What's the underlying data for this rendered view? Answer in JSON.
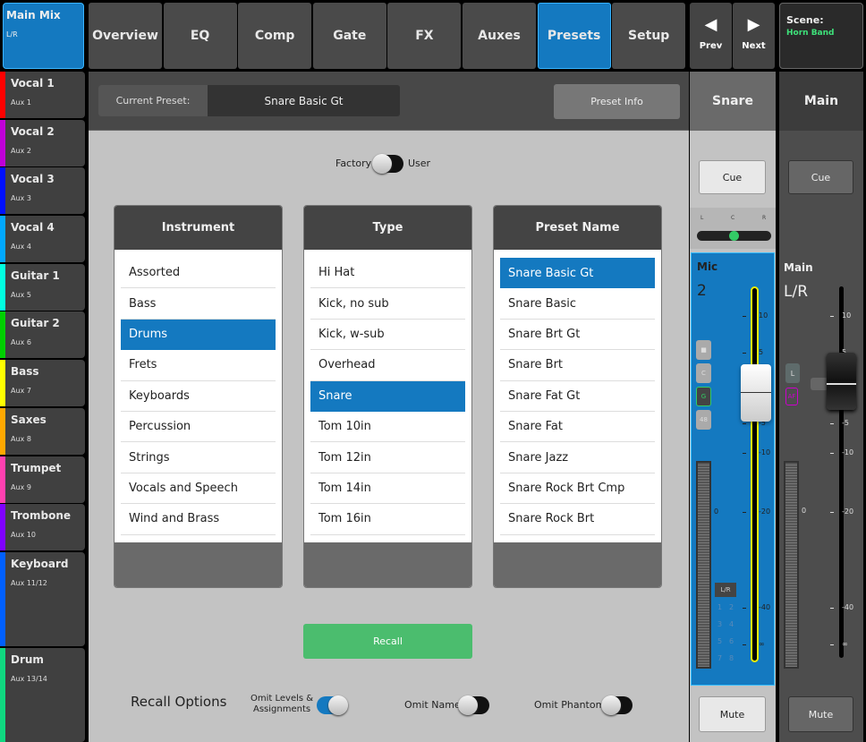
{
  "sidebar": {
    "main": {
      "name": "Main Mix",
      "sub": "L/R",
      "color": "#1479c0"
    },
    "channels": [
      {
        "name": "Vocal 1",
        "aux": "Aux 1",
        "color": "#ff0000"
      },
      {
        "name": "Vocal 2",
        "aux": "Aux 2",
        "color": "#c000d8"
      },
      {
        "name": "Vocal 3",
        "aux": "Aux 3",
        "color": "#0010ff"
      },
      {
        "name": "Vocal 4",
        "aux": "Aux 4",
        "color": "#00a8ff"
      },
      {
        "name": "Guitar 1",
        "aux": "Aux 5",
        "color": "#00ffe0"
      },
      {
        "name": "Guitar 2",
        "aux": "Aux 6",
        "color": "#00d000"
      },
      {
        "name": "Bass",
        "aux": "Aux 7",
        "color": "#ffff00"
      },
      {
        "name": "Saxes",
        "aux": "Aux 8",
        "color": "#ffa800"
      },
      {
        "name": "Trumpet",
        "aux": "Aux 9",
        "color": "#ff40b0"
      },
      {
        "name": "Trombone",
        "aux": "Aux 10",
        "color": "#8000ff"
      },
      {
        "name": "Keyboard",
        "aux": "Aux 11/12",
        "color": "#0060ff"
      },
      {
        "name": "Drum",
        "aux": "Aux 13/14",
        "color": "#10d880"
      }
    ]
  },
  "tabs": [
    {
      "label": "Overview"
    },
    {
      "label": "EQ"
    },
    {
      "label": "Comp"
    },
    {
      "label": "Gate"
    },
    {
      "label": "FX"
    },
    {
      "label": "Auxes"
    },
    {
      "label": "Presets",
      "active": true
    },
    {
      "label": "Setup"
    }
  ],
  "nav": {
    "prev": "Prev",
    "next": "Next",
    "prev_icon": "triangle-left",
    "next_icon": "triangle-right"
  },
  "scene": {
    "label": "Scene:",
    "value": "Horn Band",
    "color": "#3ee27a"
  },
  "preset": {
    "current_label": "Current Preset:",
    "current_value": "Snare Basic Gt",
    "info_button": "Preset Info",
    "factory": "Factory",
    "user": "User",
    "source": "Factory",
    "columns": [
      {
        "title": "Instrument",
        "items": [
          "Assorted",
          "Bass",
          "Drums",
          "Frets",
          "Keyboards",
          "Percussion",
          "Strings",
          "Vocals and Speech",
          "Wind and Brass"
        ],
        "selected": 2
      },
      {
        "title": "Type",
        "items": [
          "Hi Hat",
          "Kick, no sub",
          "Kick, w-sub",
          "Overhead",
          "Snare",
          "Tom 10in",
          "Tom 12in",
          "Tom 14in",
          "Tom 16in"
        ],
        "selected": 4
      },
      {
        "title": "Preset Name",
        "items": [
          "Snare Basic Gt",
          "Snare Basic",
          "Snare Brt Gt",
          "Snare Brt",
          "Snare Fat Gt",
          "Snare Fat",
          "Snare Jazz",
          "Snare Rock Brt Cmp",
          "Snare Rock Brt"
        ],
        "selected": 0
      }
    ],
    "recall": "Recall",
    "recall_color": "#4bbd6e",
    "recall_options": {
      "title": "Recall Options",
      "omit_levels_1": "Omit Levels &",
      "omit_levels_2": "Assignments",
      "omit_levels": true,
      "omit_name_label": "Omit Name",
      "omit_name": false,
      "omit_phantom_label": "Omit Phantom",
      "omit_phantom": false
    }
  },
  "strip": {
    "name": "Snare",
    "cue": "Cue",
    "type": "Mic",
    "number": "2",
    "pan_l": "L",
    "pan_c": "C",
    "pan_r": "R",
    "pan": 0.5,
    "buttons": [
      "■",
      "C",
      "G",
      "48"
    ],
    "assign": "L/R",
    "buses": [
      "1",
      "2",
      "3",
      "4",
      "5",
      "6",
      "7",
      "8"
    ],
    "meter_zero": "0",
    "mute": "Mute",
    "fader_db": 0,
    "meter_level": 0
  },
  "main": {
    "name": "Main",
    "cue": "Cue",
    "type": "Main",
    "number": "L/R",
    "buttons": [
      "L",
      "AF"
    ],
    "meter_zero": "0",
    "mute": "Mute",
    "fader_db": 0,
    "meter_level": 0,
    "pan": 0.65
  },
  "scale": [
    "10",
    "5",
    "0",
    "-5",
    "-10",
    "-20",
    "-40",
    "∞"
  ]
}
